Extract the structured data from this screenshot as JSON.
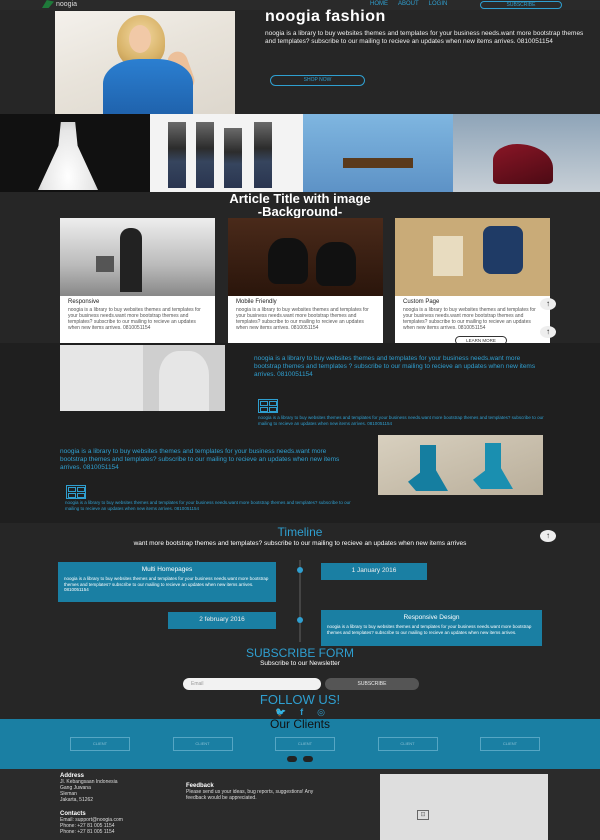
{
  "brand": {
    "name": "noogia"
  },
  "nav": {
    "links": [
      "HOME",
      "ABOUT",
      "LOGIN"
    ],
    "cta": "SUBSCRIBE"
  },
  "hero": {
    "title": "noogia fashion",
    "text": "noogia is a library to buy websites themes and templates for your business needs.want more bootstrap themes and templates? subscribe to our mailing to recieve an updates when new items arrives. 0810051154",
    "button": "SHOP NOW"
  },
  "article": {
    "title_line1": "Article Title with image",
    "title_line2": "-Background-"
  },
  "cards": [
    {
      "title": "Responsive",
      "text": "noogia is a library to buy websites themes and templates for your business needs.want more bootstrap themes and templates? subscribe to our mailing to recieve an updates when new items arrives. 0810051154",
      "button": ""
    },
    {
      "title": "Mobile Friendly",
      "text": "noogia is a library to buy websites themes and templates for your business needs.want more bootstrap themes and templates? subscribe to our mailing to recieve an updates when new items arrives. 0810051154",
      "button": ""
    },
    {
      "title": "Custom Page",
      "text": "noogia is a library to buy websites themes and templates for your business needs.want more bootstrap themes and templates? subscribe to our mailing to recieve an updates when new items arrives. 0810051154",
      "button": "LEARN MORE"
    }
  ],
  "section2": {
    "p1": "noogia is a library to buy websites themes and templates for your business needs.want more bootstrap themes and templates ? subscribe to our mailing to recieve an updates when new items arrives. 0810051154",
    "p2": "noogia is a library to buy websites themes and templates for your business needs.want more bootstrap themes and templates? subscribe to our mailing to recieve an updates when new items arrives. 0810051154",
    "p3": "noogia is a library to buy websites themes and templates for your business needs.want more bootstrap themes and templates? subscribe to our mailing to recieve an updates when new items arrives. 0810051154",
    "p4": "noogia is a library to buy websites themes and templates for your business needs.want more bootstrap themes and templates? subscribe to our mailing to recieve an updates when new items arrives. 0810051154"
  },
  "timeline": {
    "title": "Timeline",
    "subtitle": "want more bootstrap themes and templates? subscribe to our mailing to recieve an updates when new items arrives",
    "items": [
      {
        "head": "Multi Homepages",
        "body": "noogia is a library to buy websites themes and templates for your business needs.want more bootstrap themes and templates? subscribe to our mailing to recieve an updates when new items arrives. 0810051154"
      },
      {
        "head": "Responsive Design",
        "body": "noogia is a library to buy websites themes and templates for your business needs.want more bootstrap themes and templates? subscribe to our mailing to recieve an updates when new items arrives."
      }
    ],
    "dates": [
      "1 January 2016",
      "2 february 2016"
    ]
  },
  "subscribe": {
    "title": "SUBSCRIBE FORM",
    "subtitle": "Subscribe to our Newsletter",
    "placeholder": "Email",
    "button": "SUBSCRIBE"
  },
  "follow": {
    "title": "FOLLOW US!"
  },
  "clients": {
    "title": "Our Clients",
    "logos": [
      "CLIENT",
      "CLIENT",
      "CLIENT",
      "CLIENT",
      "CLIENT"
    ]
  },
  "footer": {
    "address_head": "Address",
    "address": [
      "Jl. Kebangsaan Indonesia",
      "Gang Juwana",
      "Sleman",
      "Jakarta, 51262"
    ],
    "contacts_head": "Contacts",
    "contacts": [
      "Email: support@noogia.com",
      "Phone: +27 81 005 1154",
      "Phone: +27 81 005 1154"
    ],
    "feedback_head": "Feedback",
    "feedback": "Please send us your ideas, bug reports, suggestions! Any feedback would be appreciated."
  },
  "colors": {
    "accent": "#2f9fd0",
    "band": "#1a7fa3",
    "bg": "#262626"
  }
}
